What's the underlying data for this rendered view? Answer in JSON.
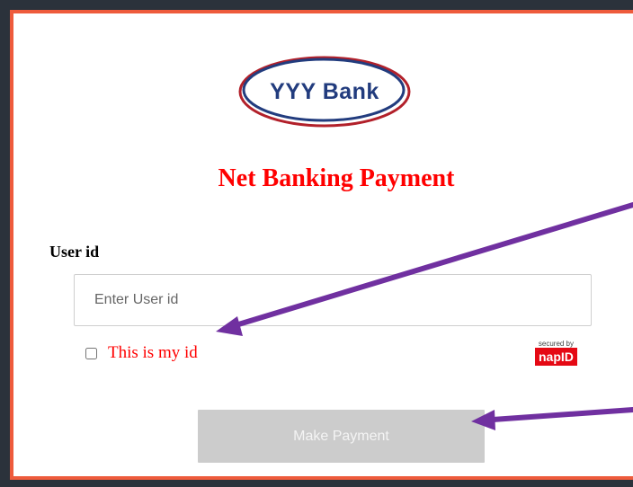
{
  "logo": {
    "text": "YYY Bank"
  },
  "page": {
    "title": "Net Banking Payment"
  },
  "form": {
    "user_label": "User id",
    "user_placeholder": "Enter User id",
    "user_value": "",
    "checkbox_label": "This is my id",
    "checkbox_checked": false,
    "submit_label": "Make Payment"
  },
  "badge": {
    "secured_by": "secured by",
    "brand": "napID"
  },
  "colors": {
    "frame_border": "#ee5b3c",
    "title": "#ff0000",
    "logo_text": "#223c7e",
    "button_bg": "#cccccc",
    "annotation_arrow": "#7030a0"
  }
}
